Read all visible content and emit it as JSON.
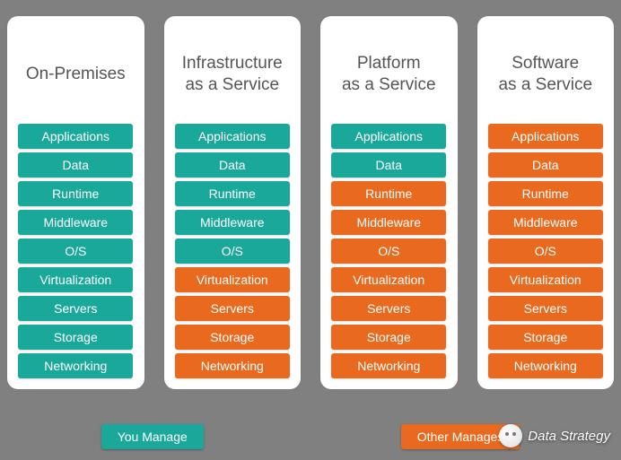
{
  "colors": {
    "you": "#1aa89a",
    "other": "#e96a1f"
  },
  "layers": [
    "Applications",
    "Data",
    "Runtime",
    "Middleware",
    "O/S",
    "Virtualization",
    "Servers",
    "Storage",
    "Networking"
  ],
  "columns": [
    {
      "title_lines": [
        "On-Premises"
      ],
      "managed_by": [
        "you",
        "you",
        "you",
        "you",
        "you",
        "you",
        "you",
        "you",
        "you"
      ]
    },
    {
      "title_lines": [
        "Infrastructure",
        "as a Service"
      ],
      "managed_by": [
        "you",
        "you",
        "you",
        "you",
        "you",
        "other",
        "other",
        "other",
        "other"
      ]
    },
    {
      "title_lines": [
        "Platform",
        "as a Service"
      ],
      "managed_by": [
        "you",
        "you",
        "other",
        "other",
        "other",
        "other",
        "other",
        "other",
        "other"
      ]
    },
    {
      "title_lines": [
        "Software",
        "as a Service"
      ],
      "managed_by": [
        "other",
        "other",
        "other",
        "other",
        "other",
        "other",
        "other",
        "other",
        "other"
      ]
    }
  ],
  "legend": {
    "you": "You Manage",
    "other": "Other Manages"
  },
  "watermark": "Data Strategy"
}
